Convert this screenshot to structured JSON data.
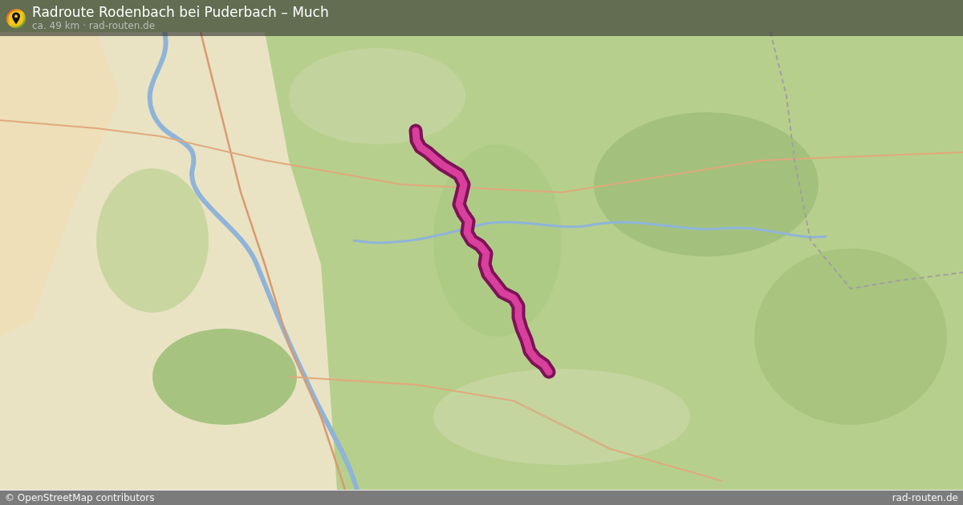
{
  "header": {
    "title": "Radroute Rodenbach bei Puderbach – Much",
    "subtitle": "ca. 49 km · rad-routen.de"
  },
  "footer": {
    "attribution": "© OpenStreetMap contributors",
    "site": "rad-routen.de"
  }
}
